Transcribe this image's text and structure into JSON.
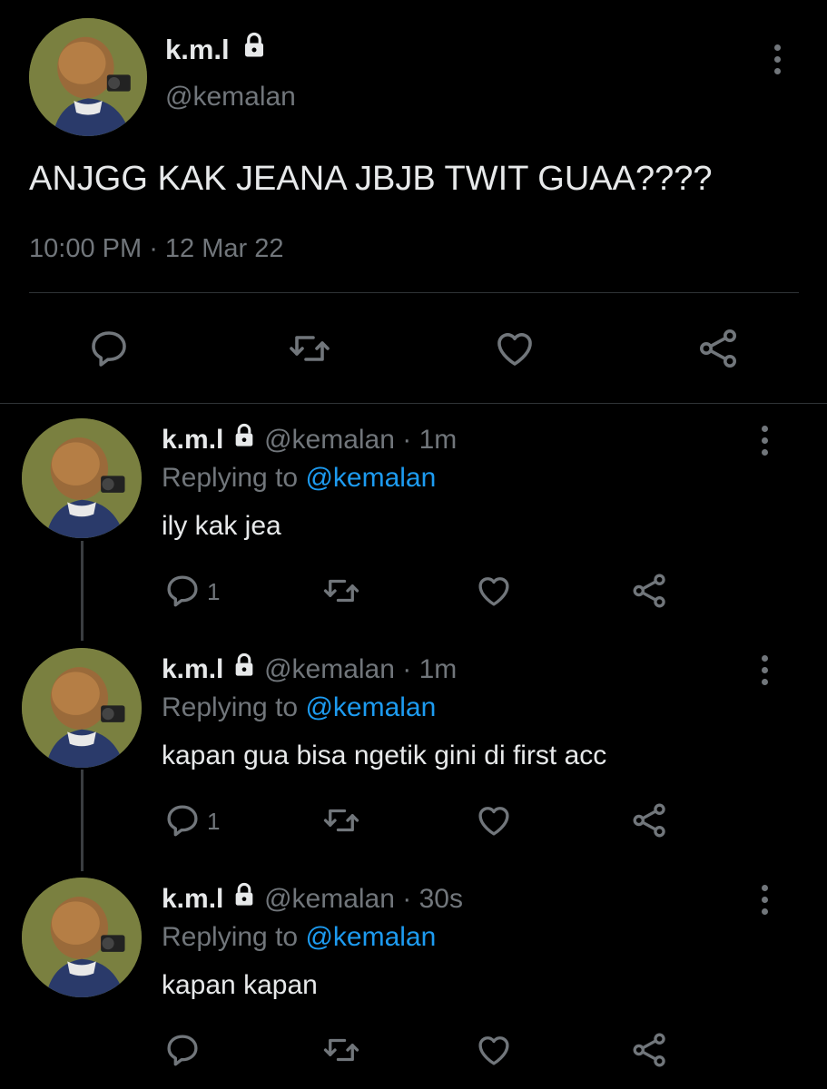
{
  "main_tweet": {
    "display_name": "k.m.l",
    "handle": "@kemalan",
    "text": "ANJGG KAK JEANA JBJB TWIT GUAA????",
    "time": "10:00 PM",
    "date": "12 Mar 22",
    "separator": " · "
  },
  "replies": [
    {
      "display_name": "k.m.l",
      "handle": "@kemalan",
      "age": "1m",
      "replying_prefix": "Replying to ",
      "replying_to": "@kemalan",
      "text": "ily kak jea",
      "reply_count": "1"
    },
    {
      "display_name": "k.m.l",
      "handle": "@kemalan",
      "age": "1m",
      "replying_prefix": "Replying to ",
      "replying_to": "@kemalan",
      "text": "kapan gua bisa ngetik gini di first acc",
      "reply_count": "1"
    },
    {
      "display_name": "k.m.l",
      "handle": "@kemalan",
      "age": "30s",
      "replying_prefix": "Replying to ",
      "replying_to": "@kemalan",
      "text": "kapan kapan",
      "reply_count": ""
    }
  ],
  "colors": {
    "background": "#000000",
    "text": "#e7e9ea",
    "muted": "#71767b",
    "link": "#1d9bf0",
    "divider": "#2f3336"
  },
  "icons": [
    "lock-icon",
    "more-icon",
    "reply-icon",
    "retweet-icon",
    "like-icon",
    "share-icon"
  ]
}
